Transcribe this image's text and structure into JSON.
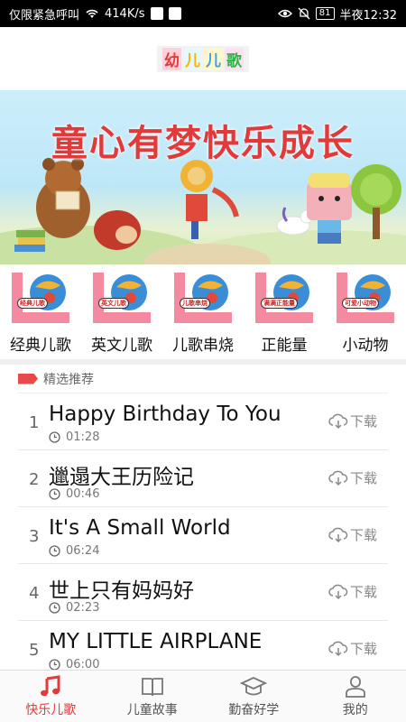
{
  "status_bar": {
    "carrier": "仅限紧急呼叫",
    "speed": "414K/s",
    "battery": "81",
    "time": "半夜12:32"
  },
  "logo": {
    "chars": [
      "幼",
      "儿",
      "儿",
      "歌"
    ]
  },
  "banner": {
    "title": "童心有梦快乐成长"
  },
  "categories": [
    {
      "label": "经典儿歌",
      "tag": "经典儿歌"
    },
    {
      "label": "英文儿歌",
      "tag": "英文儿歌"
    },
    {
      "label": "儿歌串烧",
      "tag": "儿歌串烧"
    },
    {
      "label": "正能量",
      "tag": "满满正能量"
    },
    {
      "label": "小动物",
      "tag": "可爱小动物"
    }
  ],
  "section": {
    "title": "精选推荐"
  },
  "songs": [
    {
      "num": "1",
      "title": "Happy Birthday To You",
      "duration": "01:28",
      "download": "下载"
    },
    {
      "num": "2",
      "title": "邋遢大王历险记",
      "duration": "00:46",
      "download": "下载"
    },
    {
      "num": "3",
      "title": "It's A Small World",
      "duration": "06:24",
      "download": "下载"
    },
    {
      "num": "4",
      "title": "世上只有妈妈好",
      "duration": "02:23",
      "download": "下载"
    },
    {
      "num": "5",
      "title": "MY LITTLE AIRPLANE",
      "duration": "06:00",
      "download": "下载"
    }
  ],
  "bottom_nav": [
    {
      "label": "快乐儿歌",
      "icon": "music-note-icon",
      "active": true
    },
    {
      "label": "儿童故事",
      "icon": "book-icon",
      "active": false
    },
    {
      "label": "勤奋好学",
      "icon": "graduation-cap-icon",
      "active": false
    },
    {
      "label": "我的",
      "icon": "person-icon",
      "active": false
    }
  ],
  "colors": {
    "accent": "#e23b3b",
    "banner_title": "#e03a3a",
    "statusbar": "#000000"
  }
}
